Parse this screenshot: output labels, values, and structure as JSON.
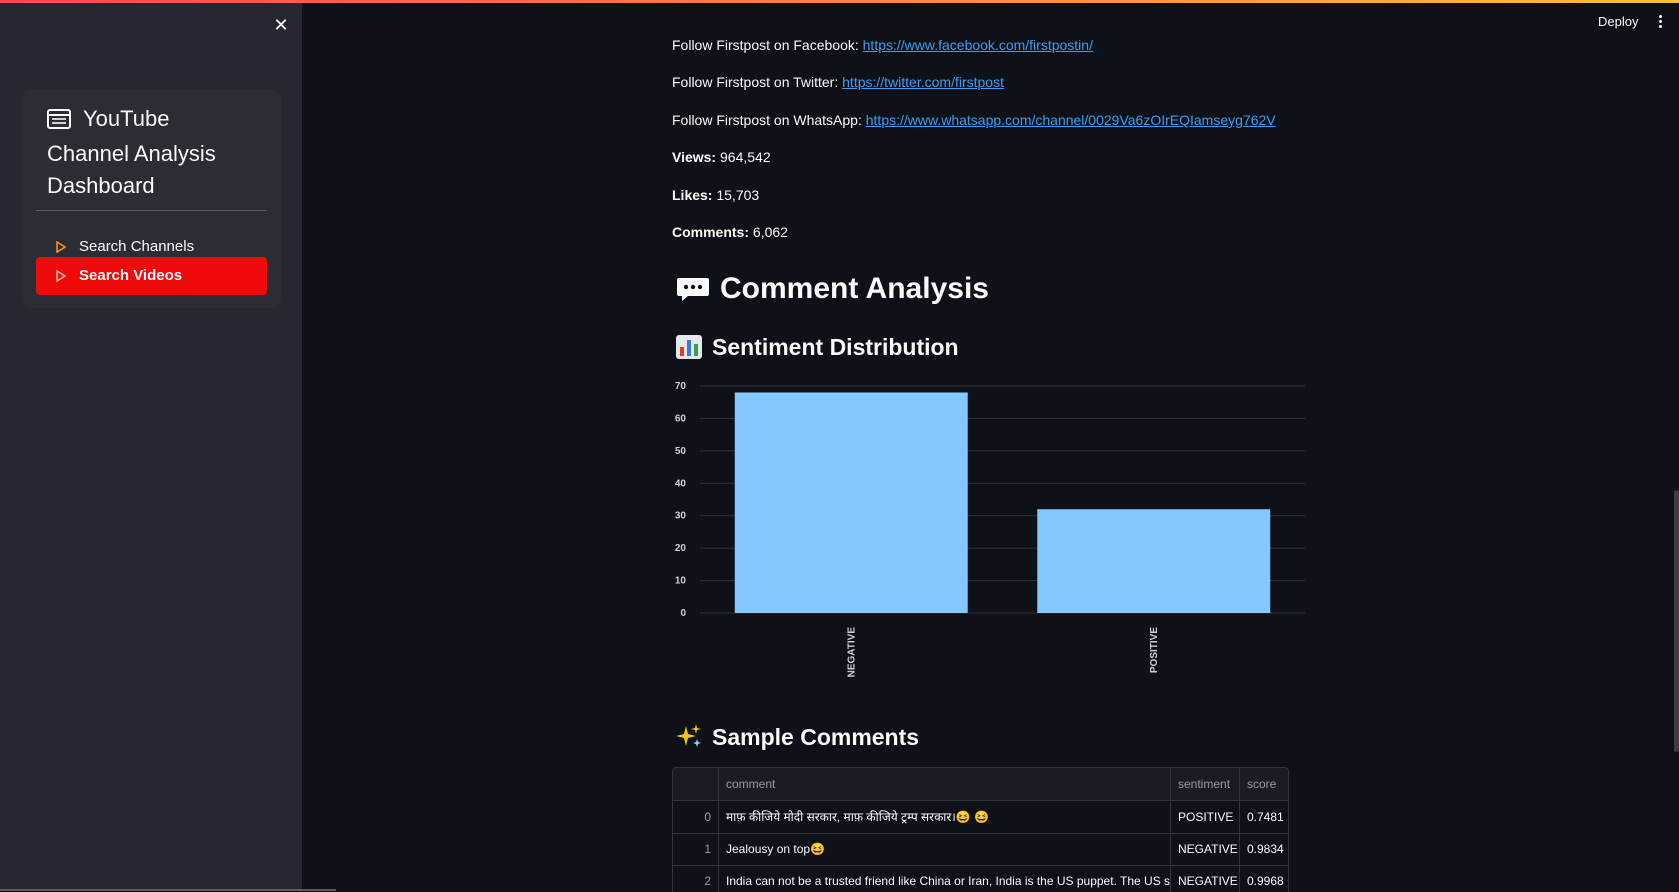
{
  "sidebar": {
    "close_glyph": "✕",
    "title": "YouTube Channel Analysis Dashboard",
    "title_icon": "list-window-icon",
    "items": [
      {
        "label": "Search Channels",
        "icon": "play-triangle-icon",
        "active": false
      },
      {
        "label": "Search Videos",
        "icon": "play-triangle-icon",
        "active": true
      }
    ],
    "accent_color": "#ee0a0a"
  },
  "header": {
    "deploy_label": "Deploy",
    "menu_icon": "kebab-menu-icon"
  },
  "video_info": {
    "facebook_prefix": "Follow Firstpost on Facebook: ",
    "facebook_url": "https://www.facebook.com/firstpostin/",
    "twitter_prefix": "Follow Firstpost on Twitter: ",
    "twitter_url": "https://twitter.com/firstpost",
    "whatsapp_prefix": "Follow Firstpost on WhatsApp: ",
    "whatsapp_url": "https://www.whatsapp.com/channel/0029Va6zOIrEQIamseyg762V",
    "views_label": "Views:",
    "views_value": "964,542",
    "likes_label": "Likes:",
    "likes_value": "15,703",
    "comments_label": "Comments:",
    "comments_value": "6,062"
  },
  "comment_analysis": {
    "emoji": "💬",
    "heading": "Comment Analysis",
    "sentiment_emoji": "📊",
    "sentiment_heading": "Sentiment Distribution",
    "samples_emoji": "✨",
    "samples_heading": "Sample Comments"
  },
  "chart_data": {
    "type": "bar",
    "categories": [
      "NEGATIVE",
      "POSITIVE"
    ],
    "values": [
      68,
      32
    ],
    "ylim": [
      0,
      70
    ],
    "yticks": [
      0,
      10,
      20,
      30,
      40,
      50,
      60,
      70
    ],
    "bar_color": "#83c9ff",
    "grid": true,
    "title": "",
    "xlabel": "",
    "ylabel": ""
  },
  "table": {
    "columns": [
      "comment",
      "sentiment",
      "score"
    ],
    "rows": [
      {
        "idx": "0",
        "comment": "माफ़ कीजिये मोदी सरकार, माफ़ कीजिये ट्रम्प सरकार।😆 😆",
        "sentiment": "POSITIVE",
        "score": "0.7481"
      },
      {
        "idx": "1",
        "comment": "Jealousy on top😆",
        "sentiment": "NEGATIVE",
        "score": "0.9834"
      },
      {
        "idx": "2",
        "comment": "India can not be a trusted friend like China or Iran, India is the US puppet. The US slav",
        "sentiment": "NEGATIVE",
        "score": "0.9968"
      }
    ]
  }
}
